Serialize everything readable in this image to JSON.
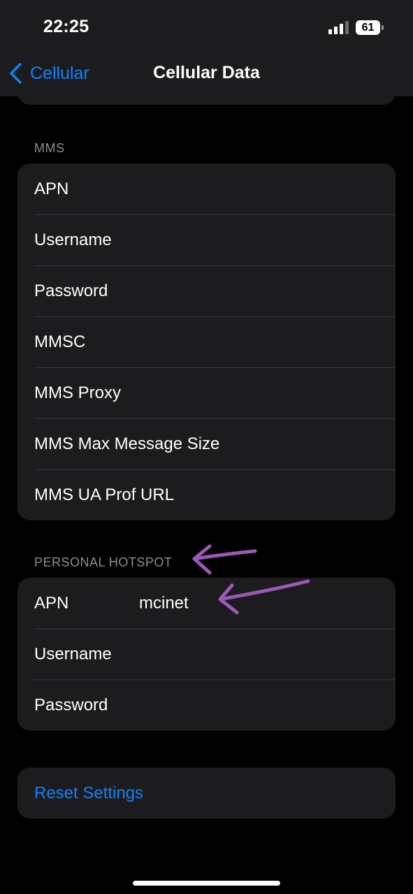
{
  "status_bar": {
    "time": "22:25",
    "battery_level": "61"
  },
  "nav": {
    "back_label": "Cellular",
    "title": "Cellular Data"
  },
  "mms": {
    "header": "MMS",
    "rows": [
      {
        "label": "APN"
      },
      {
        "label": "Username"
      },
      {
        "label": "Password"
      },
      {
        "label": "MMSC"
      },
      {
        "label": "MMS Proxy"
      },
      {
        "label": "MMS Max Message Size"
      },
      {
        "label": "MMS UA Prof URL"
      }
    ]
  },
  "hotspot": {
    "header": "PERSONAL HOTSPOT",
    "rows": [
      {
        "label": "APN",
        "value": "mcinet"
      },
      {
        "label": "Username",
        "value": ""
      },
      {
        "label": "Password",
        "value": ""
      }
    ]
  },
  "reset": {
    "label": "Reset Settings"
  },
  "colors": {
    "accent": "#0a84ff",
    "annotation_arrow": "#9b59b6",
    "group_bg": "#1c1c1e",
    "header_text": "#8e8e93"
  }
}
